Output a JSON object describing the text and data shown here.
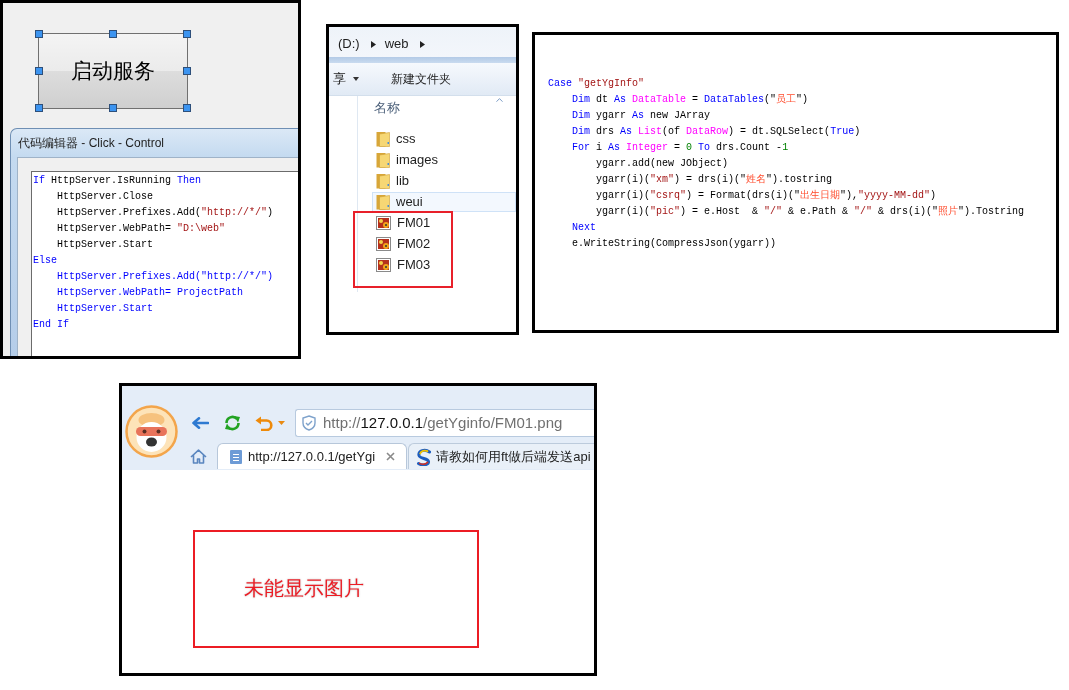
{
  "form_designer": {
    "button": {
      "label": "启动服务",
      "selected": true
    },
    "code_editor": {
      "title": "代码编辑器 - Click - Control",
      "lines": [
        {
          "tokens": [
            {
              "text": "If",
              "kind": "keyword"
            },
            {
              "text": " HttpServer.IsRunning",
              "kind": "plain"
            },
            {
              "text": " Then",
              "kind": "keyword"
            }
          ],
          "children": [
            {
              "tokens": [
                {
                  "text": "HttpServer.Close",
                  "kind": "plain"
                }
              ]
            },
            {
              "tokens": [
                {
                  "text": "HttpServer.Prefixes.Add(",
                  "kind": "plain"
                },
                {
                  "text": "\"http://*/\"",
                  "kind": "string"
                },
                {
                  "text": ")",
                  "kind": "plain"
                }
              ]
            },
            {
              "tokens": [
                {
                  "text": "HttpServer.WebPath=",
                  "kind": "plain"
                },
                {
                  "text": " \"D:\\web\"",
                  "kind": "string"
                }
              ]
            },
            {
              "tokens": [
                {
                  "text": "HttpServer.Start",
                  "kind": "plain"
                }
              ]
            }
          ]
        },
        {
          "tokens": [
            {
              "text": "Else",
              "kind": "keyword"
            }
          ],
          "children": [
            {
              "tokens": [
                {
                  "text": "HttpServer.Prefixes.Add(\"http://*/\")",
                  "kind": "keyword"
                }
              ]
            },
            {
              "tokens": [
                {
                  "text": "HttpServer.WebPath= ProjectPath",
                  "kind": "keyword"
                }
              ]
            },
            {
              "tokens": [
                {
                  "text": "HttpServer.Start",
                  "kind": "keyword"
                }
              ]
            }
          ]
        },
        {
          "tokens": [
            {
              "text": "End If",
              "kind": "keyword"
            }
          ]
        }
      ]
    }
  },
  "file_explorer": {
    "breadcrumb": [
      "(D:)",
      "web"
    ],
    "toolbar": [
      {
        "label": "享",
        "kind": "menu"
      },
      {
        "label": "新建文件夹",
        "kind": "button"
      }
    ],
    "column_header": "名称",
    "items": [
      {
        "name": "css",
        "kind": "folder",
        "selected": false
      },
      {
        "name": "images",
        "kind": "folder",
        "selected": false
      },
      {
        "name": "lib",
        "kind": "folder",
        "selected": false
      },
      {
        "name": "weui",
        "kind": "folder",
        "selected": true
      },
      {
        "name": "FM01",
        "kind": "image",
        "selected": false
      },
      {
        "name": "FM02",
        "kind": "image",
        "selected": false
      },
      {
        "name": "FM03",
        "kind": "image",
        "selected": false
      }
    ]
  },
  "code_panel": {
    "lines": [
      {
        "tokens": [
          {
            "text": "Case",
            "kind": "keyword"
          },
          {
            "text": " \"getYgInfo\"",
            "kind": "string"
          }
        ],
        "children": [
          {
            "tokens": [
              {
                "text": "Dim",
                "kind": "keyword"
              },
              {
                "text": " dt ",
                "kind": "plain"
              },
              {
                "text": "As",
                "kind": "keyword"
              },
              {
                "text": " DataTable",
                "kind": "type"
              },
              {
                "text": " = ",
                "kind": "plain"
              },
              {
                "text": "DataTables",
                "kind": "keyword"
              },
              {
                "text": "(\"",
                "kind": "plain"
              },
              {
                "text": "员工",
                "kind": "cjk"
              },
              {
                "text": "\")",
                "kind": "plain"
              }
            ]
          },
          {
            "tokens": [
              {
                "text": "Dim",
                "kind": "keyword"
              },
              {
                "text": " ygarr ",
                "kind": "plain"
              },
              {
                "text": "As",
                "kind": "keyword"
              },
              {
                "text": " new JArray",
                "kind": "plain"
              }
            ]
          },
          {
            "tokens": [
              {
                "text": "Dim",
                "kind": "keyword"
              },
              {
                "text": " drs ",
                "kind": "plain"
              },
              {
                "text": "As",
                "kind": "keyword"
              },
              {
                "text": " List",
                "kind": "type"
              },
              {
                "text": "(of ",
                "kind": "plain"
              },
              {
                "text": "DataRow",
                "kind": "type"
              },
              {
                "text": ") = dt.SQLSelect(",
                "kind": "plain"
              },
              {
                "text": "True",
                "kind": "keyword"
              },
              {
                "text": ")",
                "kind": "plain"
              }
            ]
          },
          {
            "tokens": [
              {
                "text": "For",
                "kind": "keyword"
              },
              {
                "text": " i ",
                "kind": "plain"
              },
              {
                "text": "As",
                "kind": "keyword"
              },
              {
                "text": " Integer",
                "kind": "type"
              },
              {
                "text": " = ",
                "kind": "plain"
              },
              {
                "text": "0",
                "kind": "number"
              },
              {
                "text": " To",
                "kind": "keyword"
              },
              {
                "text": " drs.Count -",
                "kind": "plain"
              },
              {
                "text": "1",
                "kind": "number"
              }
            ],
            "children": [
              {
                "tokens": [
                  {
                    "text": "ygarr.add(new JObject)",
                    "kind": "plain"
                  }
                ]
              },
              {
                "tokens": [
                  {
                    "text": "ygarr(i)(",
                    "kind": "plain"
                  },
                  {
                    "text": "\"xm\"",
                    "kind": "string"
                  },
                  {
                    "text": ") = drs(i)(\"",
                    "kind": "plain"
                  },
                  {
                    "text": "姓名",
                    "kind": "cjk"
                  },
                  {
                    "text": "\").tostring",
                    "kind": "plain"
                  }
                ]
              },
              {
                "tokens": [
                  {
                    "text": "ygarr(i)(",
                    "kind": "plain"
                  },
                  {
                    "text": "\"csrq\"",
                    "kind": "string"
                  },
                  {
                    "text": ") = Format(drs(i)(\"",
                    "kind": "plain"
                  },
                  {
                    "text": "出生日期",
                    "kind": "cjk"
                  },
                  {
                    "text": "\"),",
                    "kind": "plain"
                  },
                  {
                    "text": "\"yyyy-MM-dd\"",
                    "kind": "string"
                  },
                  {
                    "text": ")",
                    "kind": "plain"
                  }
                ]
              },
              {
                "tokens": [
                  {
                    "text": "ygarr(i)(",
                    "kind": "plain"
                  },
                  {
                    "text": "\"pic\"",
                    "kind": "string"
                  },
                  {
                    "text": ") = e.Host  & ",
                    "kind": "plain"
                  },
                  {
                    "text": "\"/\"",
                    "kind": "string"
                  },
                  {
                    "text": " & e.Path & ",
                    "kind": "plain"
                  },
                  {
                    "text": "\"/\"",
                    "kind": "string"
                  },
                  {
                    "text": " & drs(i)(\"",
                    "kind": "plain"
                  },
                  {
                    "text": "照片",
                    "kind": "cjk"
                  },
                  {
                    "text": "\").Tostring",
                    "kind": "plain"
                  }
                ]
              }
            ]
          },
          {
            "tokens": [
              {
                "text": "Next",
                "kind": "keyword"
              }
            ]
          },
          {
            "tokens": [
              {
                "text": "e.WriteString(CompressJson(ygarr))",
                "kind": "plain"
              }
            ]
          }
        ]
      }
    ]
  },
  "browser": {
    "address": {
      "scheme": "http://",
      "host": "127.0.0.1",
      "path": "/getYginfo/FM01.png"
    },
    "tabs": [
      {
        "label": "http://127.0.0.1/getYgi",
        "kind": "page",
        "selected": true
      },
      {
        "label": "请教如何用ft做后端发送api",
        "kind": "site",
        "selected": false
      }
    ],
    "page": {
      "message": "未能显示图片"
    }
  }
}
